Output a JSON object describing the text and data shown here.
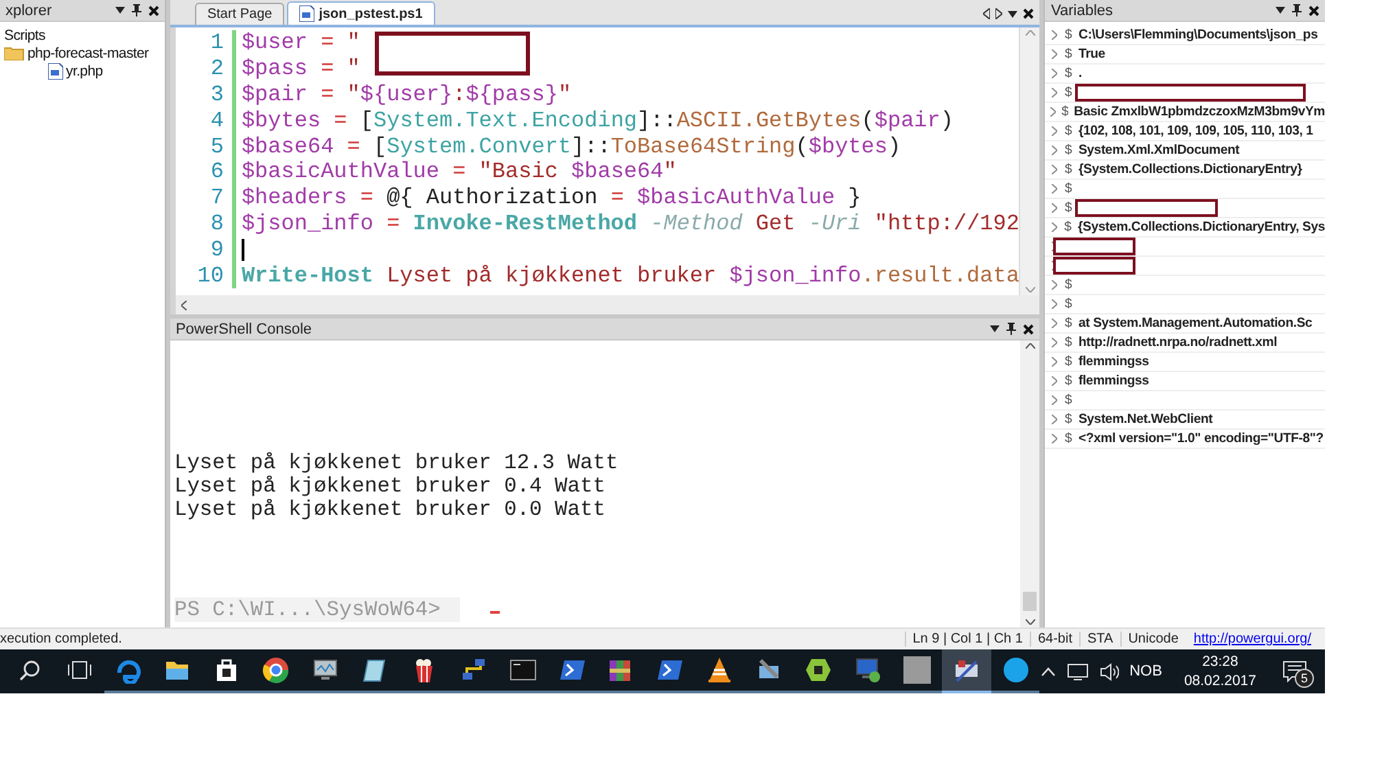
{
  "explorer": {
    "title": "xplorer",
    "tree": [
      {
        "label": "Scripts",
        "kind": "root",
        "children": [
          {
            "label": "php-forecast-master",
            "kind": "folder",
            "children": [
              {
                "label": "yr.php",
                "kind": "file"
              }
            ]
          }
        ]
      }
    ]
  },
  "editor": {
    "tabs": [
      {
        "label": "Start Page",
        "selected": false
      },
      {
        "label": "json_pstest.ps1",
        "selected": true
      }
    ],
    "lines": [
      {
        "number": "1",
        "cursor": false,
        "redacted": true,
        "tokens": [
          {
            "kind": "var",
            "text": "$user"
          },
          {
            "kind": "op",
            "text": " = "
          },
          {
            "kind": "str",
            "text": "\""
          }
        ]
      },
      {
        "number": "2",
        "cursor": false,
        "redacted": false,
        "tokens": [
          {
            "kind": "var",
            "text": "$pass"
          },
          {
            "kind": "op",
            "text": " = "
          },
          {
            "kind": "str",
            "text": "\""
          }
        ]
      },
      {
        "number": "3",
        "cursor": false,
        "redacted": false,
        "tokens": [
          {
            "kind": "var",
            "text": "$pair"
          },
          {
            "kind": "op",
            "text": " = "
          },
          {
            "kind": "str",
            "text": "\""
          },
          {
            "kind": "var",
            "text": "${user}"
          },
          {
            "kind": "str",
            "text": ":"
          },
          {
            "kind": "var",
            "text": "${pass}"
          },
          {
            "kind": "str",
            "text": "\""
          }
        ]
      },
      {
        "number": "4",
        "cursor": false,
        "redacted": false,
        "tokens": [
          {
            "kind": "var",
            "text": "$bytes"
          },
          {
            "kind": "op",
            "text": " = "
          },
          {
            "kind": "plain",
            "text": "["
          },
          {
            "kind": "type",
            "text": "System.Text.Encoding"
          },
          {
            "kind": "plain",
            "text": "]::"
          },
          {
            "kind": "member",
            "text": "ASCII.GetBytes"
          },
          {
            "kind": "plain",
            "text": "("
          },
          {
            "kind": "var",
            "text": "$pair"
          },
          {
            "kind": "plain",
            "text": ")"
          }
        ]
      },
      {
        "number": "5",
        "cursor": false,
        "redacted": false,
        "tokens": [
          {
            "kind": "var",
            "text": "$base64"
          },
          {
            "kind": "op",
            "text": " = "
          },
          {
            "kind": "plain",
            "text": "["
          },
          {
            "kind": "type",
            "text": "System.Convert"
          },
          {
            "kind": "plain",
            "text": "]::"
          },
          {
            "kind": "member",
            "text": "ToBase64String"
          },
          {
            "kind": "plain",
            "text": "("
          },
          {
            "kind": "var",
            "text": "$bytes"
          },
          {
            "kind": "plain",
            "text": ")"
          }
        ]
      },
      {
        "number": "6",
        "cursor": false,
        "redacted": false,
        "tokens": [
          {
            "kind": "var",
            "text": "$basicAuthValue"
          },
          {
            "kind": "op",
            "text": " = "
          },
          {
            "kind": "str",
            "text": "\"Basic "
          },
          {
            "kind": "var",
            "text": "$base64"
          },
          {
            "kind": "str",
            "text": "\""
          }
        ]
      },
      {
        "number": "7",
        "cursor": false,
        "redacted": false,
        "tokens": [
          {
            "kind": "var",
            "text": "$headers"
          },
          {
            "kind": "op",
            "text": " = "
          },
          {
            "kind": "plain",
            "text": "@{ Authorization "
          },
          {
            "kind": "op",
            "text": "= "
          },
          {
            "kind": "var",
            "text": "$basicAuthValue"
          },
          {
            "kind": "plain",
            "text": " }"
          }
        ]
      },
      {
        "number": "8",
        "cursor": false,
        "redacted": false,
        "tokens": [
          {
            "kind": "var",
            "text": "$json_info"
          },
          {
            "kind": "op",
            "text": " = "
          },
          {
            "kind": "cmd",
            "text": "Invoke-RestMethod"
          },
          {
            "kind": "param",
            "text": " -Method"
          },
          {
            "kind": "str",
            "text": " Get "
          },
          {
            "kind": "param",
            "text": "-Uri"
          },
          {
            "kind": "str",
            "text": " \"http://192"
          }
        ]
      },
      {
        "number": "9",
        "cursor": true,
        "redacted": false
      },
      {
        "number": "10",
        "cursor": false,
        "redacted": false,
        "tokens": [
          {
            "kind": "cmd",
            "text": "Write-Host"
          },
          {
            "kind": "str",
            "text": " Lyset på kjøkkenet bruker "
          },
          {
            "kind": "var",
            "text": "$json_info"
          },
          {
            "kind": "member",
            "text": ".result.data"
          }
        ]
      }
    ]
  },
  "console": {
    "title": "PowerShell Console",
    "lines": [
      "Lyset på kjøkkenet bruker 12.3 Watt",
      "Lyset på kjøkkenet bruker 0.4 Watt",
      "Lyset på kjøkkenet bruker 0.0 Watt"
    ],
    "prompt": "PS C:\\WI...\\SysWoW64>"
  },
  "variables": {
    "title": "Variables",
    "rows": [
      {
        "name": "$",
        "value": "C:\\Users\\Flemming\\Documents\\json_ps",
        "redacted": false
      },
      {
        "name": "$",
        "value": "True",
        "redacted": false
      },
      {
        "name": "$",
        "value": ".",
        "redacted": false
      },
      {
        "name": "$",
        "value": "",
        "redacted": true
      },
      {
        "name": "$",
        "value": "Basic ZmxlbW1pbmdzczoxMzM3bm9vYm",
        "redacted": false
      },
      {
        "name": "$",
        "value": "{102, 108, 101, 109, 109, 105, 110, 103, 1",
        "redacted": false
      },
      {
        "name": "$",
        "value": "System.Xml.XmlDocument",
        "redacted": false
      },
      {
        "name": "$",
        "value": "{System.Collections.DictionaryEntry}",
        "redacted": false
      },
      {
        "name": "$",
        "value": "",
        "redacted": false
      },
      {
        "name": "$",
        "value": "",
        "redacted": true
      },
      {
        "name": "$",
        "value": "{System.Collections.DictionaryEntry, Sys",
        "redacted": false
      },
      {
        "name": "",
        "value": "",
        "redacted": true
      },
      {
        "name": "",
        "value": "",
        "redacted": true
      },
      {
        "name": "$",
        "value": "",
        "redacted": false
      },
      {
        "name": "$",
        "value": "",
        "redacted": false
      },
      {
        "name": "$",
        "value": "   at System.Management.Automation.Sc",
        "redacted": false
      },
      {
        "name": "$",
        "value": "http://radnett.nrpa.no/radnett.xml",
        "redacted": false
      },
      {
        "name": "$",
        "value": "flemmingss",
        "redacted": false
      },
      {
        "name": "$",
        "value": "flemmingss",
        "redacted": false
      },
      {
        "name": "$",
        "value": "",
        "redacted": false
      },
      {
        "name": "$",
        "value": "System.Net.WebClient",
        "redacted": false
      },
      {
        "name": "$",
        "value": "<?xml version=\"1.0\" encoding=\"UTF-8\"?",
        "redacted": false
      }
    ]
  },
  "status_bar": {
    "message": "xecution completed.",
    "segments": [
      "Ln 9 | Col 1 | Ch 1",
      "64-bit",
      "STA",
      "Unicode"
    ],
    "link": "http://powergui.org/"
  },
  "taskbar": {
    "apps": [
      {
        "kind": "browser",
        "active": false
      },
      {
        "kind": "folder",
        "active": false
      },
      {
        "kind": "bag",
        "active": false
      },
      {
        "kind": "ring",
        "active": false
      },
      {
        "kind": "monitor",
        "active": false
      },
      {
        "kind": "notepad",
        "active": false
      },
      {
        "kind": "popcorn",
        "active": false
      },
      {
        "kind": "network",
        "active": false
      },
      {
        "kind": "terminal",
        "active": false
      },
      {
        "kind": "prompt",
        "active": false
      },
      {
        "kind": "books",
        "active": false
      },
      {
        "kind": "prompt",
        "active": false
      },
      {
        "kind": "cone",
        "active": false
      },
      {
        "kind": "tools",
        "active": false
      },
      {
        "kind": "hexagon",
        "active": false
      },
      {
        "kind": "computer",
        "active": false
      },
      {
        "kind": "photo",
        "active": false
      },
      {
        "kind": "app",
        "active": true
      },
      {
        "kind": "bubble",
        "active": false
      }
    ],
    "language": "NOB",
    "time": "23:28",
    "date": "08.02.2017",
    "notifications": "5"
  }
}
